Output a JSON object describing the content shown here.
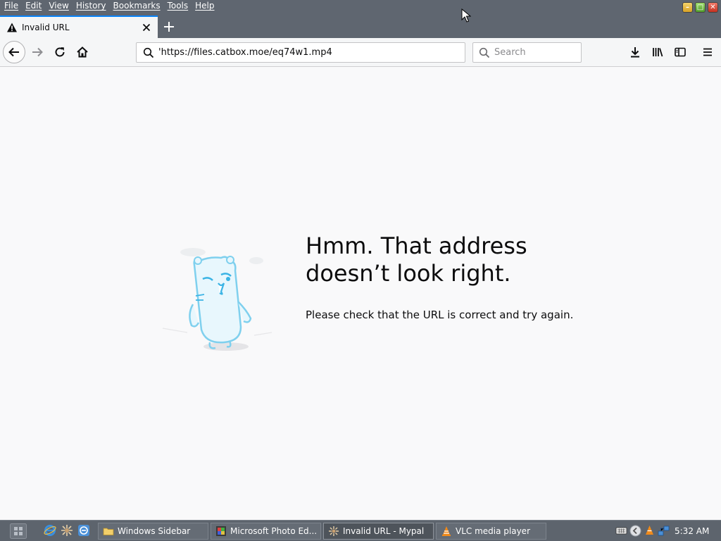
{
  "menubar": {
    "items": [
      "File",
      "Edit",
      "View",
      "History",
      "Bookmarks",
      "Tools",
      "Help"
    ]
  },
  "tab": {
    "title": "Invalid URL",
    "icon": "warning-icon"
  },
  "navbar": {
    "url": "'https://files.catbox.moe/eq74w1.mp4",
    "search_placeholder": "Search"
  },
  "error": {
    "title_line1": "Hmm. That address",
    "title_line2": "doesn’t look right.",
    "message": "Please check that the URL is correct and try again."
  },
  "taskbar": {
    "tasks": [
      {
        "label": "Windows Sidebar",
        "icon": "folder-icon"
      },
      {
        "label": "Microsoft Photo Ed...",
        "icon": "photo-editor-icon"
      },
      {
        "label": "Invalid URL - Mypal",
        "icon": "browser-icon"
      },
      {
        "label": "VLC media player",
        "icon": "vlc-icon"
      }
    ],
    "clock": "5:32 AM"
  },
  "colors": {
    "titlebar": "#5f6670",
    "accent": "#0a84ff",
    "taskbar": "#5d646d",
    "illustration": "#7fd0ee"
  }
}
